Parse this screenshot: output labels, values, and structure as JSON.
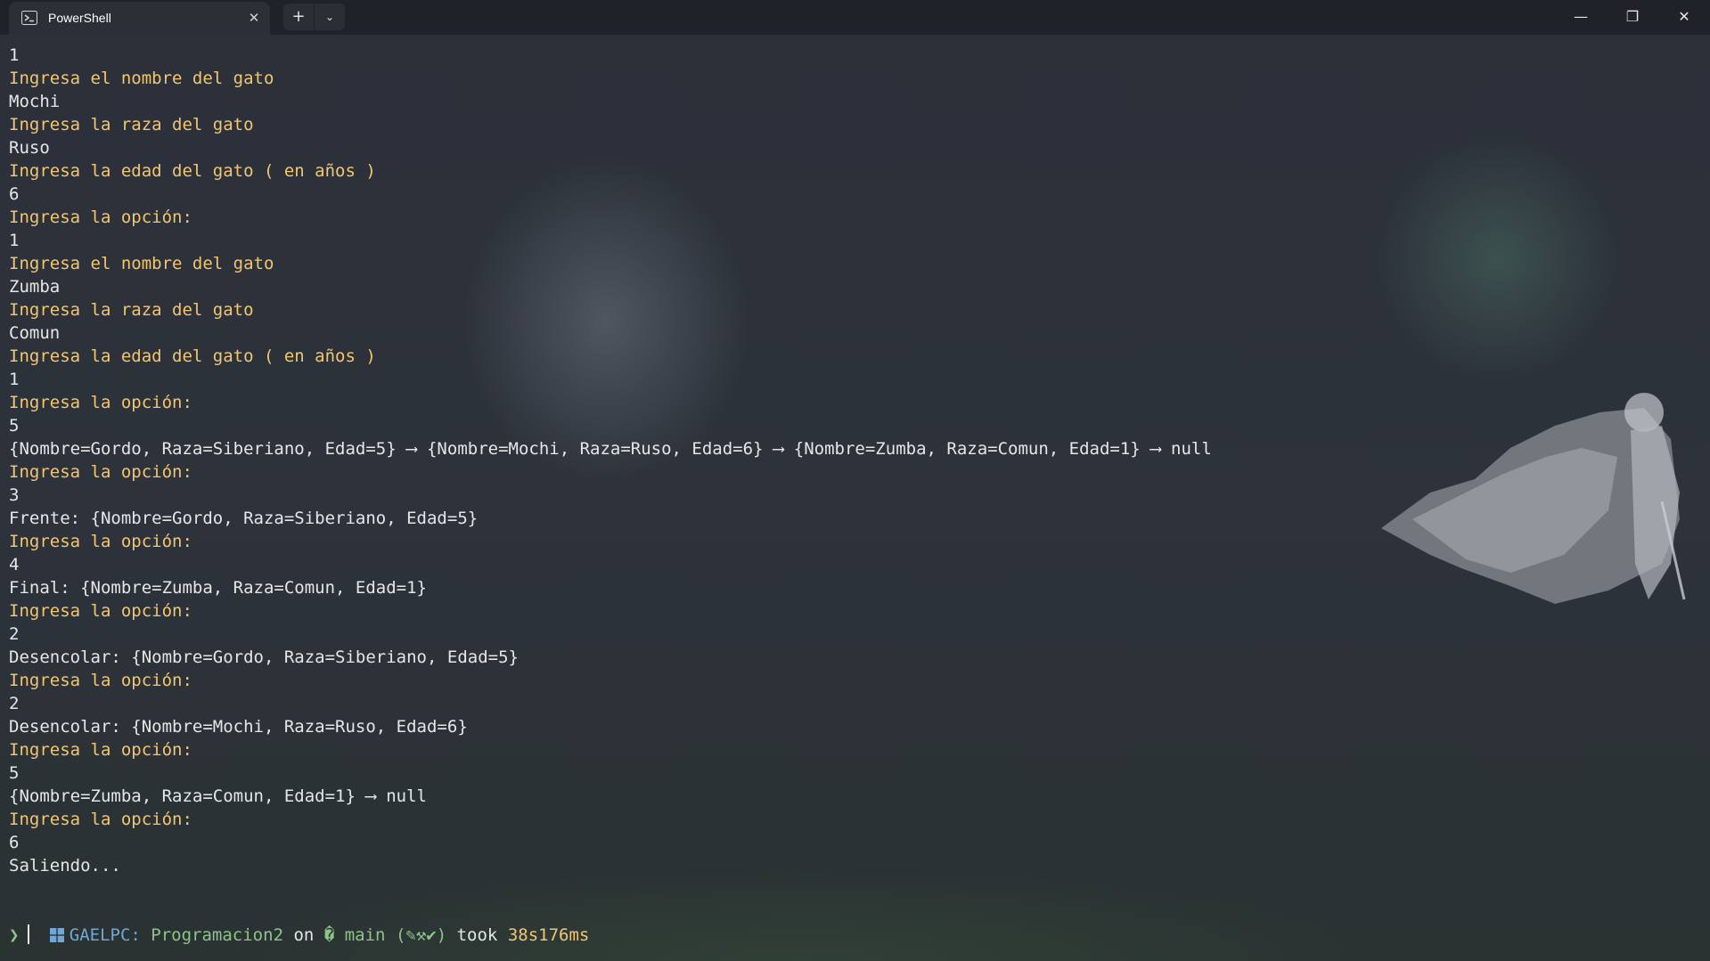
{
  "tab": {
    "title": "PowerShell",
    "icon": "powershell-icon",
    "close_label": "✕"
  },
  "titlebar": {
    "new_tab_label": "+",
    "dropdown_label": "⌄",
    "minimize_label": "—",
    "restore_label": "❐",
    "close_label": "✕"
  },
  "terminal": {
    "lines": [
      {
        "text": "1",
        "kind": "out"
      },
      {
        "text": "Ingresa el nombre del gato",
        "kind": "prompt"
      },
      {
        "text": "Mochi",
        "kind": "out"
      },
      {
        "text": "Ingresa la raza del gato",
        "kind": "prompt"
      },
      {
        "text": "Ruso",
        "kind": "out"
      },
      {
        "text": "Ingresa la edad del gato ( en años )",
        "kind": "prompt"
      },
      {
        "text": "6",
        "kind": "out"
      },
      {
        "text": "Ingresa la opción:",
        "kind": "prompt"
      },
      {
        "text": "1",
        "kind": "out"
      },
      {
        "text": "Ingresa el nombre del gato",
        "kind": "prompt"
      },
      {
        "text": "Zumba",
        "kind": "out"
      },
      {
        "text": "Ingresa la raza del gato",
        "kind": "prompt"
      },
      {
        "text": "Comun",
        "kind": "out"
      },
      {
        "text": "Ingresa la edad del gato ( en años )",
        "kind": "prompt"
      },
      {
        "text": "1",
        "kind": "out"
      },
      {
        "text": "Ingresa la opción:",
        "kind": "prompt"
      },
      {
        "text": "5",
        "kind": "out"
      },
      {
        "text": "{Nombre=Gordo, Raza=Siberiano, Edad=5} ⟶ {Nombre=Mochi, Raza=Ruso, Edad=6} ⟶ {Nombre=Zumba, Raza=Comun, Edad=1} ⟶ null",
        "kind": "out"
      },
      {
        "text": "Ingresa la opción:",
        "kind": "prompt"
      },
      {
        "text": "3",
        "kind": "out"
      },
      {
        "text": "Frente: {Nombre=Gordo, Raza=Siberiano, Edad=5}",
        "kind": "out"
      },
      {
        "text": "Ingresa la opción:",
        "kind": "prompt"
      },
      {
        "text": "4",
        "kind": "out"
      },
      {
        "text": "Final: {Nombre=Zumba, Raza=Comun, Edad=1}",
        "kind": "out"
      },
      {
        "text": "Ingresa la opción:",
        "kind": "prompt"
      },
      {
        "text": "2",
        "kind": "out"
      },
      {
        "text": "Desencolar: {Nombre=Gordo, Raza=Siberiano, Edad=5}",
        "kind": "out"
      },
      {
        "text": "Ingresa la opción:",
        "kind": "prompt"
      },
      {
        "text": "2",
        "kind": "out"
      },
      {
        "text": "Desencolar: {Nombre=Mochi, Raza=Ruso, Edad=6}",
        "kind": "out"
      },
      {
        "text": "Ingresa la opción:",
        "kind": "prompt"
      },
      {
        "text": "5",
        "kind": "out"
      },
      {
        "text": "{Nombre=Zumba, Raza=Comun, Edad=1} ⟶ null",
        "kind": "out"
      },
      {
        "text": "Ingresa la opción:",
        "kind": "prompt"
      },
      {
        "text": "6",
        "kind": "out"
      },
      {
        "text": "Saliendo...",
        "kind": "out"
      }
    ]
  },
  "status": {
    "os_icon": "windows-icon",
    "host": "GAELPC:",
    "path": "Programacion2",
    "on": "on",
    "branch_icon": "git-branch-icon",
    "branch": "main",
    "git_status": "(✎⚒✔)",
    "took": "took",
    "duration": "38s176ms"
  },
  "input": {
    "prompt_symbol": "❯"
  },
  "colors": {
    "output": "#e6e6e6",
    "prompt": "#f0c674",
    "host": "#6ea8d8",
    "path": "#8cc48a"
  }
}
